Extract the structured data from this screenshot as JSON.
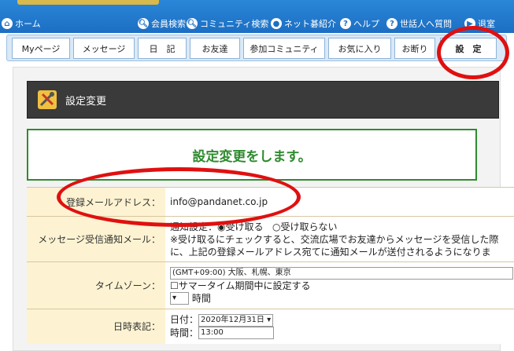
{
  "topnav": {
    "items": [
      {
        "label": "ホーム",
        "icon": "home-icon"
      },
      {
        "label": "会員検索",
        "icon": "search-icon"
      },
      {
        "label": "コミュニティ検索",
        "icon": "search-icon"
      },
      {
        "label": "ネット碁紹介",
        "icon": "globe-icon"
      },
      {
        "label": "ヘルプ",
        "icon": "help-icon"
      },
      {
        "label": "世話人へ質問",
        "icon": "question-icon"
      },
      {
        "label": "退室",
        "icon": "exit-icon"
      }
    ]
  },
  "tabs": [
    {
      "label": "Myページ"
    },
    {
      "label": "メッセージ"
    },
    {
      "label": "日　記"
    },
    {
      "label": "お友達"
    },
    {
      "label": "参加コミュニティ"
    },
    {
      "label": "お気に入り"
    },
    {
      "label": "お断り"
    },
    {
      "label": "設　定"
    }
  ],
  "page": {
    "title": "設定変更",
    "notice": "設定変更をします。"
  },
  "form": {
    "email": {
      "label": "登録メールアドレス",
      "sep": "：",
      "value": "info@pandanet.co.jp"
    },
    "message_notify": {
      "label": "メッセージ受信通知メール",
      "sep": "：",
      "prefix": "通知設定：",
      "opt1": "受け取る",
      "opt2": "受け取らない",
      "note1": "※受け取るにチェックすると、交流広場でお友達からメッセージを受信した際",
      "note2": "に、上記の登録メールアドレス宛てに通知メールが送付されるようになりま"
    },
    "timezone": {
      "label": "タイムゾーン",
      "sep": "：",
      "selected": "(GMT+09:00) 大阪、札幌、東京",
      "dst_label": "サマータイム期間中に設定する",
      "hour_suffix": "時間"
    },
    "datetime": {
      "label": "日時表記",
      "sep": "：",
      "date_prefix": "日付：",
      "date_value": "2020年12月31日",
      "time_prefix": "時間：",
      "time_value": "13:00"
    }
  },
  "colors": {
    "accent_blue": "#1c6fc3",
    "annotation_red": "#e01010",
    "notice_green": "#2e8b2e",
    "label_bg": "#fdf3d2"
  }
}
